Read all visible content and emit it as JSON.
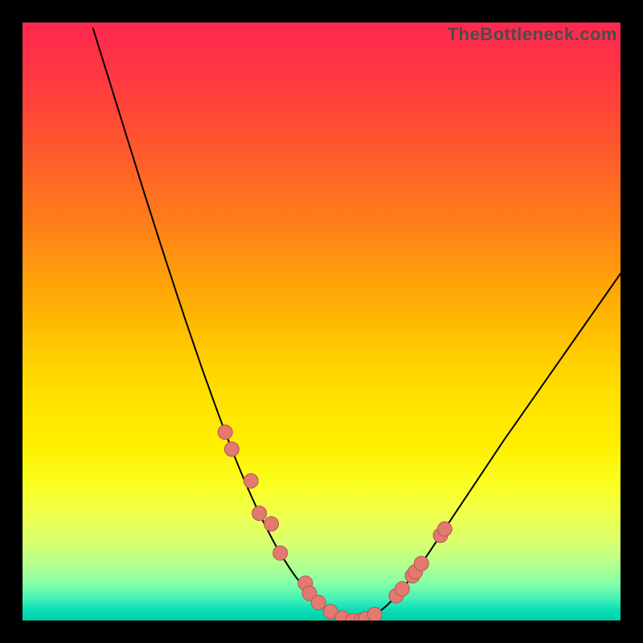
{
  "watermark": "TheBottleneck.com",
  "colors": {
    "line": "#000000",
    "marker_fill": "#e3796f",
    "marker_stroke": "#b05a52"
  },
  "chart_data": {
    "type": "line",
    "title": "",
    "xlabel": "",
    "ylabel": "",
    "xlim": [
      0,
      100
    ],
    "ylim": [
      0,
      100
    ],
    "x": [
      11.8,
      13.2,
      14.6,
      16.0,
      17.4,
      18.8,
      20.2,
      21.6,
      23.0,
      24.4,
      25.8,
      27.2,
      28.6,
      30.0,
      31.4,
      32.8,
      34.2,
      35.6,
      37.0,
      38.4,
      39.8,
      41.2,
      42.6,
      44.0,
      45.4,
      46.8,
      48.2,
      49.6,
      51.0,
      52.4,
      53.8,
      55.2,
      56.6,
      58.0,
      59.4,
      60.8,
      62.2,
      63.6,
      65.0,
      66.4,
      67.8,
      69.2,
      70.6,
      72.0,
      73.4,
      74.8,
      76.2,
      77.6,
      79.0,
      80.4,
      81.8,
      83.2,
      84.6,
      86.0,
      87.4,
      88.8,
      90.2,
      91.6,
      93.0,
      94.4,
      95.8,
      97.2,
      98.6,
      100.0
    ],
    "values": [
      99.0,
      94.5,
      90.0,
      85.5,
      81.0,
      76.5,
      72.0,
      67.6,
      63.2,
      58.9,
      54.6,
      50.4,
      46.3,
      42.2,
      38.3,
      34.4,
      30.7,
      27.1,
      23.7,
      20.5,
      17.5,
      14.7,
      12.1,
      9.8,
      7.7,
      5.9,
      4.3,
      2.9,
      1.8,
      0.9,
      0.3,
      0.0,
      0.0,
      0.5,
      1.3,
      2.4,
      3.8,
      5.4,
      7.2,
      9.1,
      11.1,
      13.2,
      15.3,
      17.4,
      19.5,
      21.6,
      23.7,
      25.8,
      27.9,
      30.0,
      32.0,
      34.0,
      36.0,
      38.0,
      40.0,
      42.0,
      44.0,
      46.0,
      48.0,
      50.0,
      52.0,
      54.0,
      56.0,
      58.0
    ],
    "markers": [
      {
        "x": 33.9,
        "y_offset": 0.0
      },
      {
        "x": 35.0,
        "y_offset": 0.0
      },
      {
        "x": 38.2,
        "y_offset": 2.4
      },
      {
        "x": 39.6,
        "y_offset": 0.0
      },
      {
        "x": 41.6,
        "y_offset": 2.2
      },
      {
        "x": 43.1,
        "y_offset": 0.0
      },
      {
        "x": 47.3,
        "y_offset": 0.9
      },
      {
        "x": 48.0,
        "y_offset": 0.0
      },
      {
        "x": 49.5,
        "y_offset": 0.0
      },
      {
        "x": 51.5,
        "y_offset": 0.0
      },
      {
        "x": 53.5,
        "y_offset": 0.0
      },
      {
        "x": 55.2,
        "y_offset": 0.0
      },
      {
        "x": 56.7,
        "y_offset": 0.0
      },
      {
        "x": 57.4,
        "y_offset": 0.0
      },
      {
        "x": 58.9,
        "y_offset": 0.0
      },
      {
        "x": 62.5,
        "y_offset": 0.0
      },
      {
        "x": 63.5,
        "y_offset": 0.0
      },
      {
        "x": 65.2,
        "y_offset": 0.0
      },
      {
        "x": 65.7,
        "y_offset": 0.0
      },
      {
        "x": 66.7,
        "y_offset": 0.0
      },
      {
        "x": 69.9,
        "y_offset": 0.0
      },
      {
        "x": 70.6,
        "y_offset": 0.0
      }
    ]
  }
}
